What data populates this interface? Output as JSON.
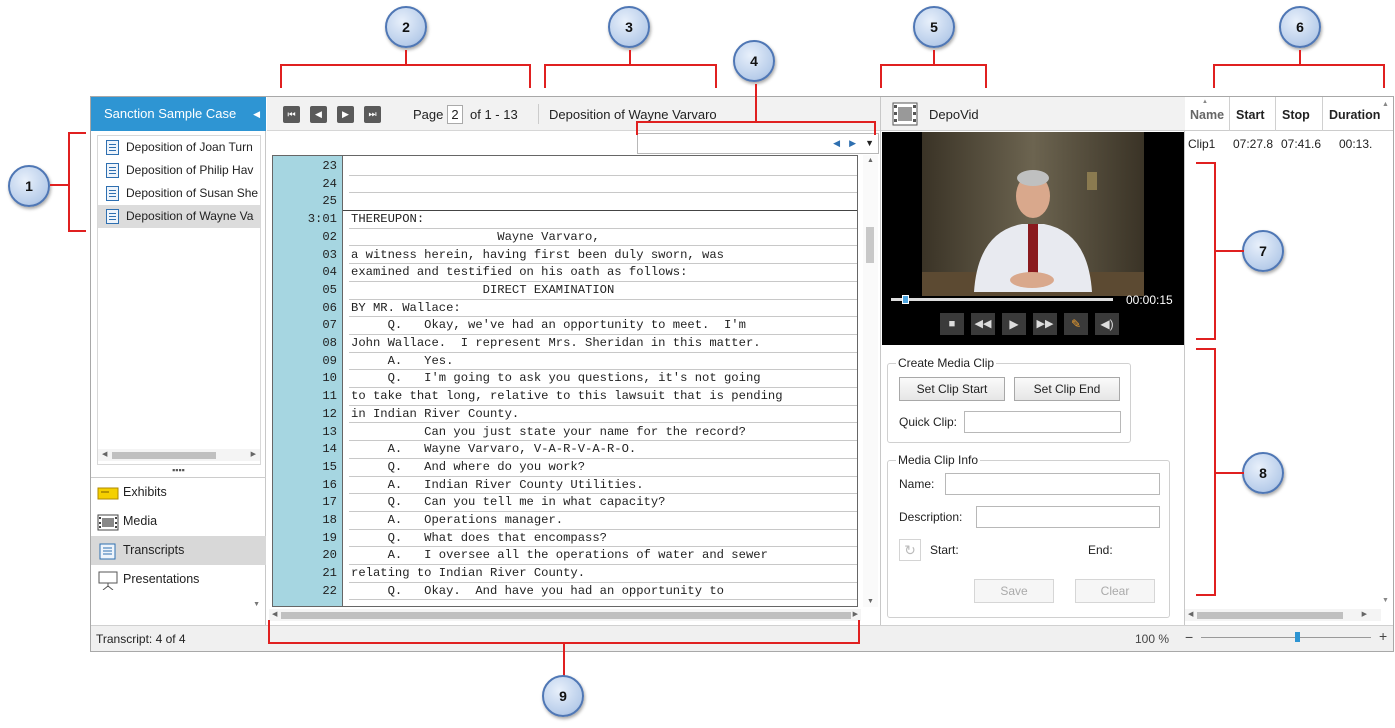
{
  "case": {
    "title": "Sanction Sample Case"
  },
  "depositions": [
    {
      "label": "Deposition of Joan Turn"
    },
    {
      "label": "Deposition of Philip Hav"
    },
    {
      "label": "Deposition of Susan She"
    },
    {
      "label": "Deposition of Wayne Va"
    }
  ],
  "nav": [
    {
      "label": "Exhibits",
      "icon": "exhibits-icon"
    },
    {
      "label": "Media",
      "icon": "film-icon"
    },
    {
      "label": "Transcripts",
      "icon": "transcript-icon"
    },
    {
      "label": "Presentations",
      "icon": "presentation-icon"
    }
  ],
  "toolbar": {
    "page_label": "Page",
    "page_value": "2",
    "page_of": "of 1 - 13",
    "title": "Deposition of Wayne Varvaro"
  },
  "transcript": {
    "lines": [
      {
        "n": "23",
        "t": ""
      },
      {
        "n": "24",
        "t": ""
      },
      {
        "n": "25",
        "t": ""
      },
      {
        "n": "3:01",
        "t": "THEREUPON:"
      },
      {
        "n": "02",
        "t": "                    Wayne Varvaro,"
      },
      {
        "n": "03",
        "t": "a witness herein, having first been duly sworn, was"
      },
      {
        "n": "04",
        "t": "examined and testified on his oath as follows:"
      },
      {
        "n": "05",
        "t": "                  DIRECT EXAMINATION"
      },
      {
        "n": "06",
        "t": "BY MR. Wallace:"
      },
      {
        "n": "07",
        "t": "     Q.   Okay, we've had an opportunity to meet.  I'm"
      },
      {
        "n": "08",
        "t": "John Wallace.  I represent Mrs. Sheridan in this matter."
      },
      {
        "n": "09",
        "t": "     A.   Yes."
      },
      {
        "n": "10",
        "t": "     Q.   I'm going to ask you questions, it's not going"
      },
      {
        "n": "11",
        "t": "to take that long, relative to this lawsuit that is pending"
      },
      {
        "n": "12",
        "t": "in Indian River County."
      },
      {
        "n": "13",
        "t": "          Can you just state your name for the record?"
      },
      {
        "n": "14",
        "t": "     A.   Wayne Varvaro, V-A-R-V-A-R-O."
      },
      {
        "n": "15",
        "t": "     Q.   And where do you work?"
      },
      {
        "n": "16",
        "t": "     A.   Indian River County Utilities."
      },
      {
        "n": "17",
        "t": "     Q.   Can you tell me in what capacity?"
      },
      {
        "n": "18",
        "t": "     A.   Operations manager."
      },
      {
        "n": "19",
        "t": "     Q.   What does that encompass?"
      },
      {
        "n": "20",
        "t": "     A.   I oversee all the operations of water and sewer"
      },
      {
        "n": "21",
        "t": "relating to Indian River County."
      },
      {
        "n": "22",
        "t": "     Q.   Okay.  And have you had an opportunity to"
      }
    ]
  },
  "video": {
    "title": "DepoVid",
    "time": "00:00:15",
    "progress": 0.05
  },
  "media_clip": {
    "title": "Create Media Clip",
    "set_start": "Set Clip Start",
    "set_end": "Set Clip End",
    "quick_clip": "Quick Clip:"
  },
  "clip_info": {
    "title": "Media Clip Info",
    "name": "Name:",
    "description": "Description:",
    "start": "Start:",
    "end": "End:",
    "save": "Save",
    "clear": "Clear"
  },
  "clips": {
    "headers": [
      "Name",
      "Start",
      "Stop",
      "Duration"
    ],
    "rows": [
      [
        "Clip1",
        "07:27.8",
        "07:41.6",
        "00:13."
      ]
    ]
  },
  "status": {
    "left": "Transcript: 4 of 4",
    "zoom": "100 %",
    "zoom_level": 0.55
  },
  "callouts": [
    "1",
    "2",
    "3",
    "4",
    "5",
    "6",
    "7",
    "8",
    "9"
  ],
  "colors": {
    "accent": "#2e95d3",
    "line_numbers": "#a6d6e1",
    "callout_line": "#e02020"
  }
}
